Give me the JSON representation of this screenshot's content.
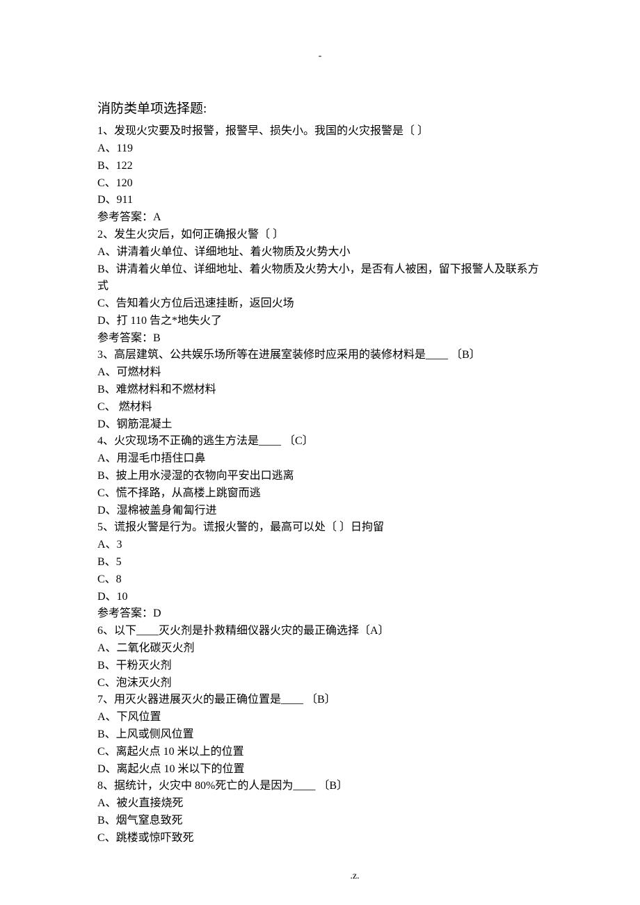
{
  "topMark": "-",
  "title": "消防类单项选择题:",
  "questions": [
    {
      "stem": "1、发现火灾要及时报警，报警早、损失小。我国的火灾报警是〔 〕",
      "opts": [
        "A、119",
        "B、122",
        "C、120",
        "D、911"
      ],
      "answer": "参考答案：A"
    },
    {
      "stem": "2、发生火灾后，如何正确报火警〔 〕",
      "opts": [
        "A、讲清着火单位、详细地址、着火物质及火势大小",
        "B、讲清着火单位、详细地址、着火物质及火势大小，是否有人被困，留下报警人及联系方式",
        "C、告知着火方位后迅速挂断，返回火场",
        "D、打 110 告之*地失火了"
      ],
      "answer": "参考答案：B"
    },
    {
      "stem": "3、高层建筑、公共娱乐场所等在进展室装修时应采用的装修材料是____ 〔B〕",
      "opts": [
        "A、可燃材料",
        "B、难燃材料和不燃材料",
        "C、 燃材料",
        "D、钢筋混凝土"
      ],
      "answer": ""
    },
    {
      "stem": "4、火灾现场不正确的逃生方法是____ 〔C〕",
      "opts": [
        "A、用湿毛巾捂住口鼻",
        "B、披上用水浸湿的衣物向平安出口逃离",
        "C、慌不择路，从高楼上跳窗而逃",
        "D、湿棉被盖身匍匐行进"
      ],
      "answer": ""
    },
    {
      "stem": "5、谎报火警是行为。谎报火警的，最高可以处〔 〕日拘留",
      "opts": [
        "A、3",
        "B、5",
        "C、8",
        "D、10"
      ],
      "answer": "参考答案：D"
    },
    {
      "stem": "6、以下____灭火剂是扑救精细仪器火灾的最正确选择〔A〕",
      "opts": [
        "A、二氧化碳灭火剂",
        "B、干粉灭火剂",
        "C、泡沫灭火剂"
      ],
      "answer": ""
    },
    {
      "stem": "7、用灭火器进展灭火的最正确位置是____ 〔B〕",
      "opts": [
        "A、下风位置",
        "B、上风或侧风位置",
        "C、离起火点 10 米以上的位置",
        "D、离起火点 10 米以下的位置"
      ],
      "answer": ""
    },
    {
      "stem": "8、据统计，火灾中 80%死亡的人是因为____ 〔B〕",
      "opts": [
        "A、被火直接烧死",
        "B、烟气窒息致死",
        "C、跳楼或惊吓致死"
      ],
      "answer": ""
    }
  ],
  "footerLeft": ".",
  "footerRight": "z."
}
